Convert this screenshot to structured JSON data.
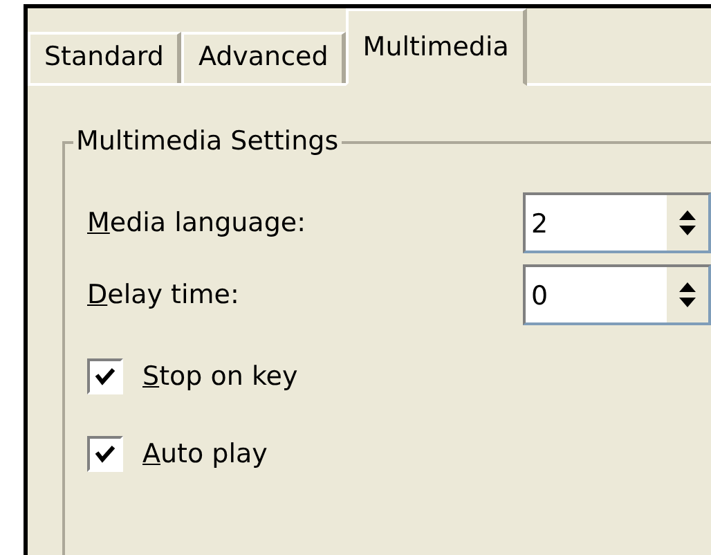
{
  "tabs": [
    {
      "label": "Standard",
      "selected": false
    },
    {
      "label": "Advanced",
      "selected": false
    },
    {
      "label": "Multimedia",
      "selected": true
    }
  ],
  "group": {
    "title": "Multimedia Settings",
    "fields": [
      {
        "access_key": "M",
        "label_rest": "edia language:",
        "value": "2"
      },
      {
        "access_key": "D",
        "label_rest": "elay time:",
        "value": "0"
      }
    ],
    "checkboxes": [
      {
        "access_key": "S",
        "label_rest": "top on key",
        "checked": true
      },
      {
        "access_key": "A",
        "label_rest": "uto play",
        "checked": true
      }
    ]
  }
}
